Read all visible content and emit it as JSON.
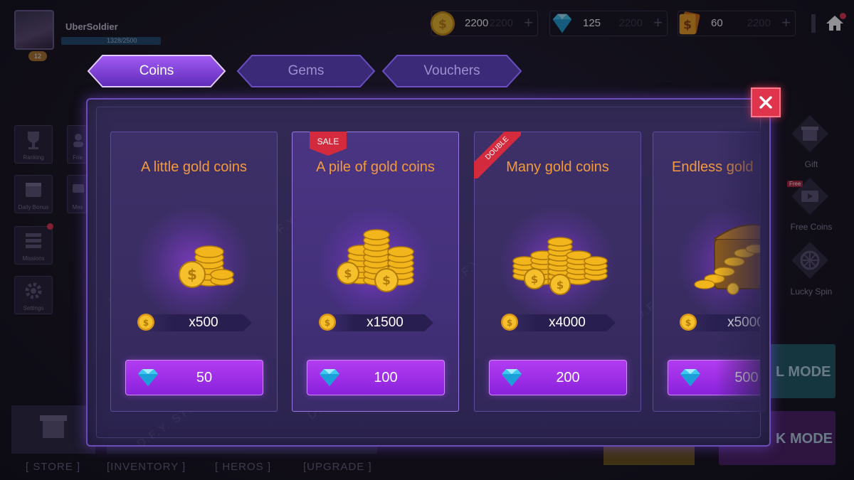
{
  "player": {
    "name": "UberSoldier",
    "xp": "1328/2500",
    "level": "12"
  },
  "resources": [
    {
      "name": "coins",
      "value": "2200",
      "ghost": "2200",
      "icon": "coin-icon"
    },
    {
      "name": "gems",
      "value": "125",
      "ghost": "2200",
      "icon": "gem-icon"
    },
    {
      "name": "vouchers",
      "value": "60",
      "ghost": "2200",
      "icon": "voucher-icon"
    }
  ],
  "left_menu": [
    {
      "label": "Ranking",
      "icon": "trophy-icon"
    },
    {
      "label": "Frie",
      "icon": "friends-icon"
    },
    {
      "label": "Daily Bonus",
      "icon": "calendar-icon"
    },
    {
      "label": "Mes",
      "icon": "message-icon"
    },
    {
      "label": "Missions",
      "icon": "list-icon"
    },
    {
      "label": "Settings",
      "icon": "gear-icon"
    }
  ],
  "right_menu": [
    {
      "label": "Gift",
      "icon": "gift-icon"
    },
    {
      "label": "Free Coins",
      "badge": "Free",
      "icon": "video-icon"
    },
    {
      "label": "Lucky Spin",
      "icon": "wheel-icon"
    }
  ],
  "bottom_nav": [
    "[ STORE ]",
    "[INVENTORY ]",
    "[ HEROS ]",
    "[UPGRADE ]"
  ],
  "modes": [
    "L MODE",
    "K MODE"
  ],
  "tabs": [
    {
      "label": "Coins",
      "active": true
    },
    {
      "label": "Gems",
      "active": false
    },
    {
      "label": "Vouchers",
      "active": false
    }
  ],
  "watermark": "D.F.Y. STUDIO",
  "offers": [
    {
      "title": "A little gold coins",
      "amount": "x500",
      "price": "50",
      "ribbon": "",
      "selected": false
    },
    {
      "title": "A pile of gold coins",
      "amount": "x1500",
      "price": "100",
      "ribbon": "SALE",
      "selected": true
    },
    {
      "title": "Many gold coins",
      "amount": "x4000",
      "price": "200",
      "ribbon": "DOUBLE",
      "selected": false
    },
    {
      "title": "Endless gold",
      "amount": "x5000",
      "price": "500",
      "ribbon": "",
      "selected": false
    }
  ],
  "colors": {
    "accent": "#9b3ff0",
    "title_orange": "#f39a3c",
    "close_red": "#e0344c",
    "panel": "#2c2450"
  }
}
